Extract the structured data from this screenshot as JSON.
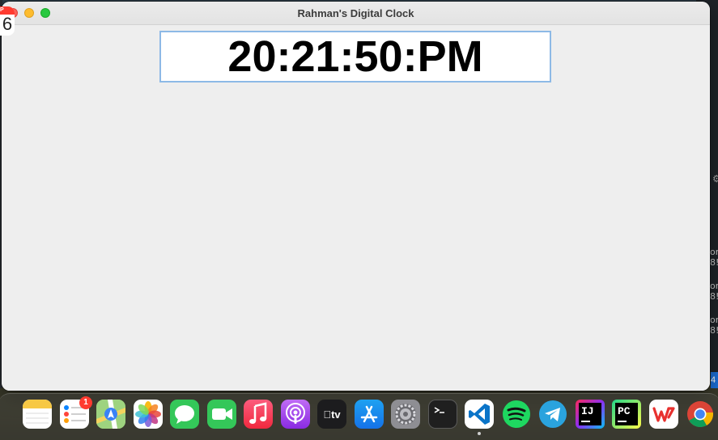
{
  "window": {
    "title": "Rahman's Digital Clock"
  },
  "clock": {
    "time_text": "20:21:50:PM"
  },
  "dock": {
    "reminders_badge": "1",
    "calendar_month": "EP",
    "calendar_day": "6",
    "tv_label": "tv",
    "intellij_label": "IJ",
    "pycharm_label": "PC",
    "items": [
      {
        "name": "calendar"
      },
      {
        "name": "notes"
      },
      {
        "name": "reminders"
      },
      {
        "name": "maps"
      },
      {
        "name": "photos"
      },
      {
        "name": "messages"
      },
      {
        "name": "facetime"
      },
      {
        "name": "music"
      },
      {
        "name": "podcasts"
      },
      {
        "name": "apple-tv"
      },
      {
        "name": "app-store"
      },
      {
        "name": "system-settings"
      },
      {
        "name": "terminal"
      },
      {
        "name": "vscode"
      },
      {
        "name": "spotify"
      },
      {
        "name": "telegram"
      },
      {
        "name": "intellij"
      },
      {
        "name": "pycharm"
      },
      {
        "name": "wps-office"
      },
      {
        "name": "chrome"
      }
    ]
  },
  "background": {
    "fragments": [
      "or",
      "8!",
      "or",
      "8!",
      "or",
      "8!"
    ],
    "edge_badge": "4"
  },
  "colors": {
    "clock_border": "#8db9e6",
    "close": "#fe5f57",
    "minimize": "#febc2e",
    "maximize": "#28c840"
  }
}
